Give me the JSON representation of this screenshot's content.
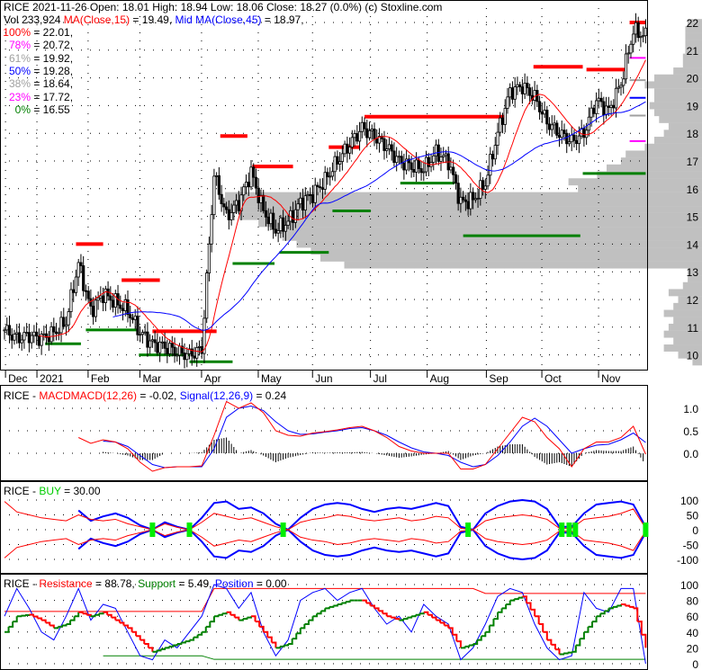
{
  "header": {
    "line1": "RICE  2021-11-26 Open: 18.01  High: 18.94  Low: 18.06  Close: 18.27 (0.0%)  (c) Stoxline.com",
    "vol": "Vol 233,924 ",
    "ma15": "MA(Close,15)",
    "ma15_val": " = 19.49, ",
    "ma45": "Mid MA(Close,45)",
    "ma45_val": " = 18.97,",
    "fib": [
      {
        "label": "100%",
        "value": " = 22.01,",
        "color": "red"
      },
      {
        "label": "78%",
        "value": " = 20.72,",
        "color": "mag"
      },
      {
        "label": "61%",
        "value": " = 19.92,",
        "color": "gray"
      },
      {
        "label": "50%",
        "value": " = 19.28,",
        "color": "blue"
      },
      {
        "label": "38%",
        "value": " = 18.64,",
        "color": "gray"
      },
      {
        "label": "23%",
        "value": " = 17.72,",
        "color": "mag"
      },
      {
        "label": "0%",
        "value": " = 16.55",
        "color": "dgreen"
      }
    ]
  },
  "macd_header": {
    "prefix": "RICE - ",
    "macd": "MACDMACD(12,26)",
    "macd_val": " = -0.02, ",
    "signal": "Signal(12,26,9)",
    "signal_val": " = 0.24"
  },
  "buy_header": {
    "prefix": "RICE - ",
    "buy": "BUY",
    "val": " = 30.00"
  },
  "rs_header": {
    "prefix": "RICE - ",
    "res": "Resistance",
    "res_val": " = 88.78, ",
    "sup": "Support",
    "sup_val": " = 5.49, ",
    "pos": "Position",
    "pos_val": " = 0.00"
  },
  "chart_data": [
    {
      "type": "candlestick",
      "title": "RICE daily price",
      "x_unit": "week index (Dec 2020 - Nov 2021)",
      "months": [
        {
          "label": "Dec",
          "week": 0.3
        },
        {
          "label": "2021",
          "week": 2.85
        },
        {
          "label": "Feb",
          "week": 7
        },
        {
          "label": "Mar",
          "week": 11.2
        },
        {
          "label": "Apr",
          "week": 16.2
        },
        {
          "label": "May",
          "week": 20.8
        },
        {
          "label": "Jun",
          "week": 25.2
        },
        {
          "label": "Jul",
          "week": 29.9
        },
        {
          "label": "Aug",
          "week": 34.5
        },
        {
          "label": "Sep",
          "week": 39.3
        },
        {
          "label": "Oct",
          "week": 43.8
        },
        {
          "label": "Nov",
          "week": 48.4
        }
      ],
      "weekly_close": [
        10.9,
        10.6,
        10.7,
        10.6,
        10.8,
        11.2,
        13.3,
        11.6,
        12.2,
        11.9,
        11.6,
        10.8,
        10.4,
        10.3,
        10.1,
        10.0,
        10.2,
        16.5,
        15.0,
        15.5,
        16.6,
        15.2,
        14.5,
        14.8,
        15.5,
        15.8,
        16.3,
        17.0,
        17.6,
        18.2,
        17.9,
        17.5,
        17.0,
        16.8,
        16.7,
        17.3,
        17.0,
        15.5,
        15.6,
        16.2,
        18.0,
        19.5,
        19.7,
        19.3,
        18.4,
        18.0,
        17.7,
        18.0,
        19.2,
        18.8,
        19.8,
        21.7,
        21.5
      ],
      "ma_periods": [
        15,
        45
      ],
      "ylim": [
        9.6,
        22.4
      ],
      "yticks": [
        "22",
        "21",
        "20",
        "19",
        "18",
        "17",
        "16",
        "15",
        "14",
        "13",
        "12",
        "11",
        "10"
      ],
      "levels": [
        {
          "price": 14.0,
          "from": 5.8,
          "to": 8.0,
          "color": "#ff0000"
        },
        {
          "price": 12.7,
          "from": 9.5,
          "to": 12.6,
          "color": "#ff0000"
        },
        {
          "price": 10.85,
          "from": 12.0,
          "to": 17.2,
          "color": "#ff0000"
        },
        {
          "price": 17.9,
          "from": 17.5,
          "to": 19.7,
          "color": "#ff0000"
        },
        {
          "price": 16.8,
          "from": 20.1,
          "to": 23.4,
          "color": "#ff0000"
        },
        {
          "price": 17.5,
          "from": 26.3,
          "to": 28.8,
          "color": "#ff0000"
        },
        {
          "price": 18.6,
          "from": 29.2,
          "to": 40.5,
          "color": "#ff0000"
        },
        {
          "price": 20.4,
          "from": 42.9,
          "to": 46.9,
          "color": "#ff0000"
        },
        {
          "price": 20.3,
          "from": 47.2,
          "to": 50.4,
          "color": "#ff0000"
        },
        {
          "price": 22.0,
          "from": 50.7,
          "to": 52,
          "color": "#ff0000"
        },
        {
          "price": 10.4,
          "from": 3.3,
          "to": 6.2,
          "color": "#008000"
        },
        {
          "price": 10.9,
          "from": 6.6,
          "to": 10.9,
          "color": "#008000"
        },
        {
          "price": 10.0,
          "from": 10.9,
          "to": 15,
          "color": "#008000"
        },
        {
          "price": 9.75,
          "from": 15,
          "to": 18.5,
          "color": "#008000"
        },
        {
          "price": 13.3,
          "from": 18.5,
          "to": 21.9,
          "color": "#008000"
        },
        {
          "price": 13.7,
          "from": 22.3,
          "to": 26.3,
          "color": "#008000"
        },
        {
          "price": 15.2,
          "from": 26.6,
          "to": 29.7,
          "color": "#008000"
        },
        {
          "price": 16.2,
          "from": 32.1,
          "to": 36.5,
          "color": "#008000"
        },
        {
          "price": 14.3,
          "from": 37.2,
          "to": 46.7,
          "color": "#008000"
        },
        {
          "price": 16.55,
          "from": 46.9,
          "to": 52,
          "color": "#008000"
        }
      ],
      "fib_levels": [
        {
          "price": 20.72,
          "color": "#ff00ff"
        },
        {
          "price": 19.92,
          "color": "#a0a0a0"
        },
        {
          "price": 19.28,
          "color": "#0000ff"
        },
        {
          "price": 18.64,
          "color": "#a0a0a0"
        },
        {
          "price": 17.72,
          "color": "#ff00ff"
        }
      ],
      "volume_profile": [
        [
          9.75,
          0.02
        ],
        [
          10,
          0.05
        ],
        [
          10.25,
          0.08
        ],
        [
          10.5,
          0.06
        ],
        [
          10.75,
          0.08
        ],
        [
          11,
          0.07
        ],
        [
          11.25,
          0.06
        ],
        [
          11.5,
          0.08
        ],
        [
          11.75,
          0.06
        ],
        [
          12,
          0.05
        ],
        [
          12.25,
          0.07
        ],
        [
          12.5,
          0.04
        ],
        [
          12.75,
          0.03
        ],
        [
          13,
          0.03
        ],
        [
          13.25,
          0.75
        ],
        [
          13.5,
          0.8
        ],
        [
          13.75,
          0.82
        ],
        [
          14,
          0.85
        ],
        [
          14.25,
          0.88
        ],
        [
          14.5,
          0.9
        ],
        [
          14.75,
          0.93
        ],
        [
          15,
          0.97
        ],
        [
          15.25,
          1.0
        ],
        [
          15.5,
          1.0
        ],
        [
          15.75,
          1.0
        ],
        [
          16,
          0.26
        ],
        [
          16.25,
          0.28
        ],
        [
          16.5,
          0.22
        ],
        [
          16.75,
          0.2
        ],
        [
          17,
          0.17
        ],
        [
          17.25,
          0.16
        ],
        [
          17.5,
          0.12
        ],
        [
          17.75,
          0.1
        ],
        [
          18,
          0.08
        ],
        [
          18.25,
          0.07
        ],
        [
          18.5,
          0.09
        ],
        [
          18.75,
          0.1
        ],
        [
          19,
          0.11
        ],
        [
          19.25,
          0.1
        ],
        [
          19.5,
          0.1
        ],
        [
          19.75,
          0.12
        ],
        [
          20,
          0.1
        ],
        [
          20.25,
          0.06
        ],
        [
          20.5,
          0.04
        ],
        [
          20.75,
          0.04
        ],
        [
          21,
          0.035
        ],
        [
          21.25,
          0.035
        ],
        [
          21.5,
          0.035
        ],
        [
          21.75,
          0.035
        ],
        [
          22,
          0.03
        ]
      ]
    },
    {
      "type": "line",
      "title": "MACD",
      "ylim": [
        -0.6,
        1.3
      ],
      "yticks": [
        {
          "v": 1.0,
          "label": "1.0"
        },
        {
          "v": 0.5,
          "label": "0.5"
        },
        {
          "v": 0.0,
          "label": "0.0"
        }
      ],
      "macd": [
        null,
        null,
        null,
        null,
        null,
        null,
        0.35,
        0.22,
        0.3,
        0.25,
        0.1,
        -0.2,
        -0.4,
        -0.32,
        -0.3,
        -0.3,
        -0.28,
        0.4,
        1.15,
        1.0,
        1.12,
        0.9,
        0.5,
        0.4,
        0.38,
        0.45,
        0.48,
        0.52,
        0.57,
        0.6,
        0.5,
        0.35,
        0.15,
        0.05,
        0.0,
        0.0,
        0.0,
        -0.35,
        -0.35,
        -0.25,
        0.1,
        0.45,
        0.8,
        0.7,
        0.35,
        0.1,
        -0.3,
        0.1,
        0.25,
        0.25,
        0.35,
        0.6,
        -0.02
      ],
      "signal": [
        null,
        null,
        null,
        null,
        null,
        null,
        null,
        null,
        0.27,
        0.25,
        0.15,
        -0.05,
        -0.25,
        -0.32,
        -0.3,
        -0.3,
        -0.3,
        0.1,
        0.8,
        1.0,
        1.05,
        0.95,
        0.7,
        0.5,
        0.42,
        0.43,
        0.47,
        0.5,
        0.55,
        0.57,
        0.5,
        0.4,
        0.25,
        0.12,
        0.03,
        0.0,
        -0.05,
        -0.2,
        -0.3,
        -0.25,
        -0.05,
        0.25,
        0.6,
        0.78,
        0.6,
        0.3,
        0.0,
        0.1,
        0.18,
        0.2,
        0.3,
        0.45,
        0.24
      ]
    },
    {
      "type": "line",
      "title": "BUY",
      "ylim": [
        -110,
        110
      ],
      "yticks": [
        {
          "v": 100,
          "label": "100"
        },
        {
          "v": 50,
          "label": "50"
        },
        {
          "v": 0,
          "label": "0"
        },
        {
          "v": -50,
          "label": "-50"
        },
        {
          "v": -100,
          "label": "-100"
        }
      ],
      "outer_band": [
        null,
        null,
        null,
        null,
        null,
        null,
        65,
        30,
        45,
        55,
        40,
        15,
        0,
        25,
        10,
        0,
        40,
        90,
        95,
        70,
        75,
        55,
        20,
        0,
        40,
        70,
        85,
        90,
        85,
        70,
        60,
        70,
        75,
        70,
        80,
        90,
        80,
        10,
        0,
        55,
        80,
        95,
        100,
        95,
        70,
        10,
        10,
        55,
        85,
        90,
        95,
        85,
        10
      ],
      "inner_band": [
        95,
        60,
        50,
        40,
        35,
        30,
        50,
        35,
        30,
        35,
        20,
        10,
        0,
        20,
        8,
        0,
        25,
        55,
        45,
        35,
        40,
        25,
        10,
        0,
        25,
        35,
        40,
        50,
        45,
        35,
        30,
        35,
        40,
        30,
        35,
        45,
        40,
        5,
        0,
        30,
        40,
        45,
        50,
        45,
        35,
        5,
        5,
        35,
        40,
        45,
        55,
        70,
        5
      ],
      "buy_signals": [
        12,
        15,
        22.6,
        37.6,
        45.2,
        45.8,
        46.3,
        52
      ]
    },
    {
      "type": "line",
      "title": "Resistance / Support / Position",
      "ylim": [
        -3,
        105
      ],
      "yticks": [
        {
          "v": 100,
          "label": "100"
        },
        {
          "v": 80,
          "label": "80"
        },
        {
          "v": 60,
          "label": "60"
        },
        {
          "v": 40,
          "label": "40"
        },
        {
          "v": 20,
          "label": "20"
        },
        {
          "v": 0,
          "label": "0"
        }
      ],
      "position": [
        60,
        95,
        70,
        40,
        30,
        60,
        95,
        55,
        75,
        70,
        40,
        10,
        5,
        30,
        20,
        40,
        60,
        100,
        95,
        70,
        90,
        40,
        10,
        30,
        80,
        90,
        95,
        80,
        90,
        95,
        70,
        50,
        60,
        40,
        75,
        60,
        50,
        5,
        20,
        50,
        85,
        95,
        90,
        50,
        20,
        5,
        10,
        90,
        70,
        65,
        95,
        95,
        0
      ],
      "stochastic": [
        40,
        60,
        62,
        55,
        45,
        50,
        65,
        60,
        65,
        55,
        45,
        30,
        15,
        20,
        25,
        30,
        40,
        60,
        65,
        55,
        60,
        40,
        20,
        25,
        45,
        60,
        70,
        75,
        80,
        80,
        70,
        60,
        55,
        60,
        65,
        55,
        45,
        20,
        25,
        40,
        65,
        80,
        85,
        60,
        30,
        12,
        15,
        40,
        60,
        70,
        75,
        70,
        20
      ],
      "resistance": [
        66,
        66,
        66,
        66,
        66,
        66,
        66,
        66,
        66,
        66,
        66,
        66,
        66,
        66,
        66,
        66,
        66,
        95,
        95,
        95,
        95,
        95,
        95,
        95,
        95,
        95,
        95,
        95,
        95,
        95,
        95,
        95,
        95,
        95,
        95,
        95,
        95,
        95,
        95,
        88.78,
        88.78,
        88.78,
        88.78,
        88.78,
        88.78,
        88.78,
        88.78,
        88.78,
        88.78,
        88.78,
        88.78,
        88.78,
        88.78
      ],
      "support": [
        null,
        null,
        null,
        null,
        null,
        null,
        null,
        null,
        10,
        10,
        10,
        10,
        10,
        10,
        10,
        10,
        10,
        5.49,
        5.49,
        5.49,
        5.49,
        5.49,
        5.49,
        5.49,
        5.49,
        5.49,
        5.49,
        5.49,
        5.49,
        5.49,
        5.49,
        5.49,
        5.49,
        5.49,
        5.49,
        5.49,
        5.49,
        5.49,
        5.49,
        5.49,
        5.49,
        5.49,
        5.49,
        5.49,
        5.49,
        5.49,
        5.49,
        5.49,
        5.49,
        5.49,
        5.49,
        5.49,
        5.49
      ]
    }
  ]
}
